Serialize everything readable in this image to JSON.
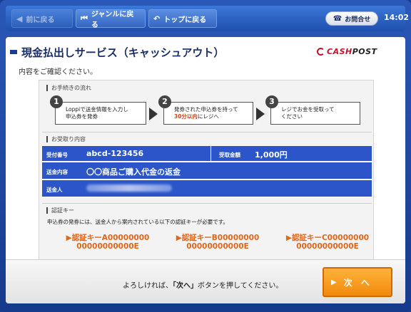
{
  "nav": {
    "back": {
      "label": "前に戻る",
      "icon": "back-arrow-icon"
    },
    "genre": {
      "label": "ジャンルに戻る",
      "icon": "rewind-icon"
    },
    "top": {
      "label": "トップに戻る",
      "icon": "return-arrow-icon"
    },
    "contact": {
      "label": "お問合せ",
      "icon": "phone-icon"
    },
    "time": "14:02"
  },
  "page": {
    "title": "現金払出しサービス（キャッシュアウト）",
    "subtitle": "内容をご確認ください。",
    "logo": {
      "cash": "CASH",
      "post": "POST"
    }
  },
  "flow": {
    "label": "お手続きの流れ",
    "steps": [
      {
        "num": "1",
        "line1": "Loppiで送金情報を入力し",
        "line2": "申込券を発券"
      },
      {
        "num": "2",
        "line1": "発券された申込券を持って",
        "line2_hl": "30分以内",
        "line2_rest": "にレジへ"
      },
      {
        "num": "3",
        "line1": "レジでお金を受取って",
        "line2": "ください"
      }
    ]
  },
  "receipt": {
    "label": "お受取り内容",
    "receipt_no_label": "受付番号",
    "receipt_no": "abcd-123456",
    "amount_label": "受取金額",
    "amount": "1,000円",
    "content_label": "送金内容",
    "content": "〇〇商品ご購入代金の返金",
    "sender_label": "送金人"
  },
  "auth": {
    "label": "認証キー",
    "note": "申込券の発券には、送金人から案内されている以下の認証キーが必要です。",
    "keys": [
      {
        "line1": "▶認証キーA00000000",
        "line2": "00000000000E"
      },
      {
        "line1": "▶認証キーB00000000",
        "line2": "00000000000E"
      },
      {
        "line1": "▶認証キーC00000000",
        "line2": "00000000000E"
      }
    ]
  },
  "footer": {
    "confirm_pre": "よろしければ、",
    "confirm_btn": "「次へ」",
    "confirm_post": "ボタンを押してください。",
    "next_label": "次　へ",
    "next_icon": "play-icon"
  },
  "colors": {
    "accent": "#2b55c8",
    "orange": "#f28a0c",
    "frame": "#1a3d8f"
  }
}
